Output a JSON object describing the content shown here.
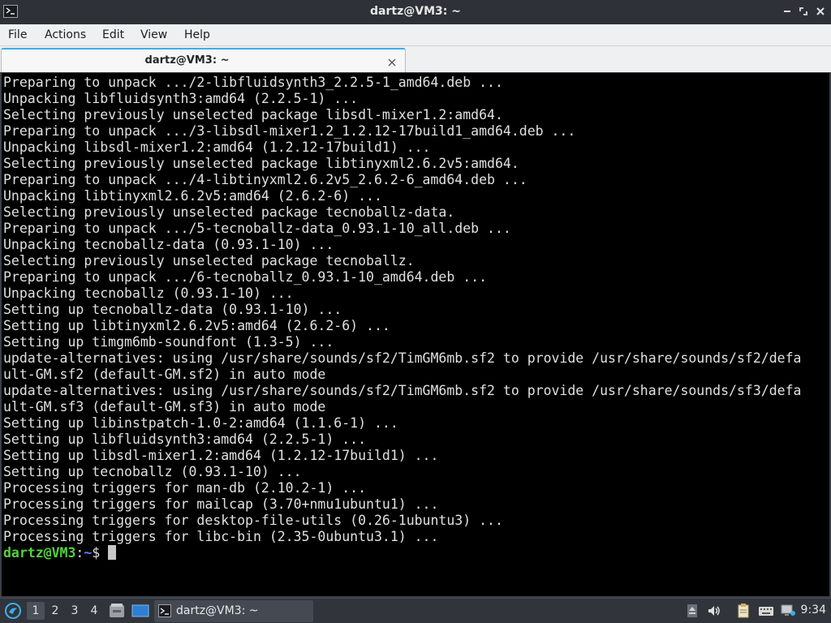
{
  "window": {
    "title": "dartz@VM3: ~"
  },
  "menu": {
    "file": "File",
    "actions": "Actions",
    "edit": "Edit",
    "view": "View",
    "help": "Help"
  },
  "tab": {
    "label": "dartz@VM3: ~"
  },
  "terminal": {
    "lines": [
      "Preparing to unpack .../2-libfluidsynth3_2.2.5-1_amd64.deb ...",
      "Unpacking libfluidsynth3:amd64 (2.2.5-1) ...",
      "Selecting previously unselected package libsdl-mixer1.2:amd64.",
      "Preparing to unpack .../3-libsdl-mixer1.2_1.2.12-17build1_amd64.deb ...",
      "Unpacking libsdl-mixer1.2:amd64 (1.2.12-17build1) ...",
      "Selecting previously unselected package libtinyxml2.6.2v5:amd64.",
      "Preparing to unpack .../4-libtinyxml2.6.2v5_2.6.2-6_amd64.deb ...",
      "Unpacking libtinyxml2.6.2v5:amd64 (2.6.2-6) ...",
      "Selecting previously unselected package tecnoballz-data.",
      "Preparing to unpack .../5-tecnoballz-data_0.93.1-10_all.deb ...",
      "Unpacking tecnoballz-data (0.93.1-10) ...",
      "Selecting previously unselected package tecnoballz.",
      "Preparing to unpack .../6-tecnoballz_0.93.1-10_amd64.deb ...",
      "Unpacking tecnoballz (0.93.1-10) ...",
      "Setting up tecnoballz-data (0.93.1-10) ...",
      "Setting up libtinyxml2.6.2v5:amd64 (2.6.2-6) ...",
      "Setting up timgm6mb-soundfont (1.3-5) ...",
      "update-alternatives: using /usr/share/sounds/sf2/TimGM6mb.sf2 to provide /usr/share/sounds/sf2/defa",
      "ult-GM.sf2 (default-GM.sf2) in auto mode",
      "update-alternatives: using /usr/share/sounds/sf2/TimGM6mb.sf2 to provide /usr/share/sounds/sf3/defa",
      "ult-GM.sf3 (default-GM.sf3) in auto mode",
      "Setting up libinstpatch-1.0-2:amd64 (1.1.6-1) ...",
      "Setting up libfluidsynth3:amd64 (2.2.5-1) ...",
      "Setting up libsdl-mixer1.2:amd64 (1.2.12-17build1) ...",
      "Setting up tecnoballz (0.93.1-10) ...",
      "Processing triggers for man-db (2.10.2-1) ...",
      "Processing triggers for mailcap (3.70+nmu1ubuntu1) ...",
      "Processing triggers for desktop-file-utils (0.26-1ubuntu3) ...",
      "Processing triggers for libc-bin (2.35-0ubuntu3.1) ..."
    ],
    "prompt": {
      "user_host": "dartz@VM3",
      "separator": ":",
      "path": "~",
      "symbol": "$"
    }
  },
  "taskbar": {
    "workspaces": [
      "1",
      "2",
      "3",
      "4"
    ],
    "active_workspace": "1",
    "task_label": "dartz@VM3: ~",
    "clock": "9:34"
  },
  "icons": {
    "app": "terminal-icon",
    "minimize": "minimize-icon",
    "maximize": "maximize-icon",
    "close": "close-icon",
    "start": "lxqt-logo-icon",
    "file_manager": "file-manager-icon",
    "desktop": "show-desktop-icon",
    "tray": [
      "eject-icon",
      "volume-icon",
      "clipboard-icon",
      "keyboard-icon",
      "network-icon"
    ]
  },
  "colors": {
    "prompt_user": "#54d23c",
    "prompt_path": "#5c7cff",
    "tab_accent": "#3daee9"
  }
}
